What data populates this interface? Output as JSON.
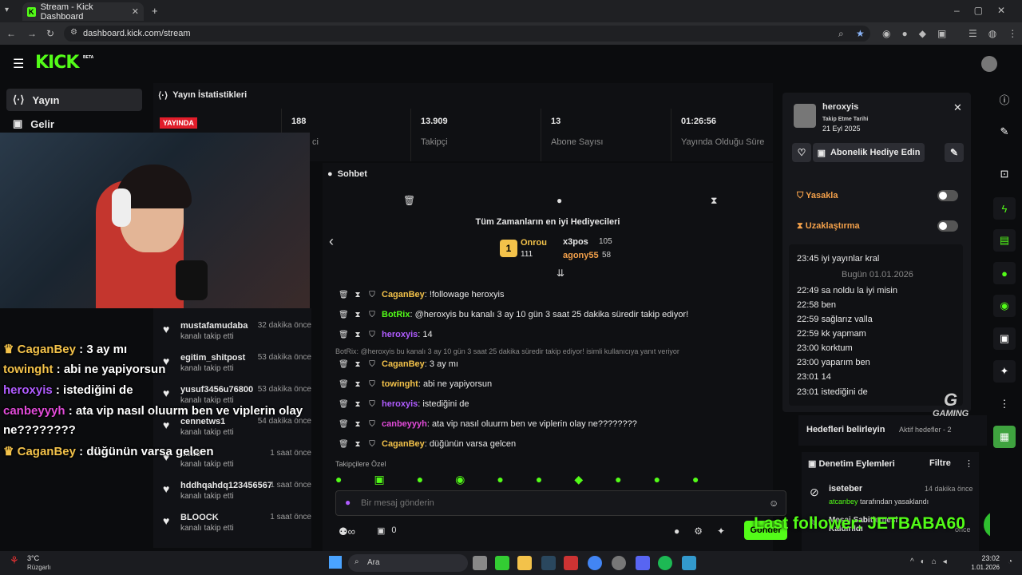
{
  "browser": {
    "tab_title": "Stream - Kick Dashboard",
    "url": "dashboard.kick.com/stream"
  },
  "kick": {
    "logo": "KICK",
    "beta": "BETA"
  },
  "sidebar": {
    "items": [
      {
        "label": "Yayın",
        "icon": "broadcast-icon"
      },
      {
        "label": "Gelir",
        "icon": "revenue-icon"
      }
    ]
  },
  "stats": {
    "title": "Yayın İstatistikleri",
    "live_badge": "YAYINDA",
    "viewers_value": "188",
    "viewers_label": "ci",
    "followers_value": "13.909",
    "followers_label": "Takipçi",
    "subs_value": "13",
    "subs_label": "Abone Sayısı",
    "duration_value": "01:26:56",
    "duration_label": "Yayında Olduğu Süre"
  },
  "overlay_chat": [
    {
      "user": "CaganBey",
      "text": " : 3 ay mı",
      "color": "#f3c24a",
      "crown": true
    },
    {
      "user": "towinght",
      "text": " : abi ne yapiyorsun",
      "color": "#f3c24a",
      "crown": false
    },
    {
      "user": "heroxyis",
      "text": " : istediğini de",
      "color": "#b05cff",
      "crown": false
    },
    {
      "user": "canbeyyyh",
      "text": " : ata vip nasıl oluurm ben ve viplerin olay",
      "color": "#e24bd9",
      "crown": false
    },
    {
      "user": "",
      "text": "ne????????",
      "color": "#ffffff",
      "crown": false
    },
    {
      "user": "CaganBey",
      "text": " : düğünün varsa gelcen",
      "color": "#f3c24a",
      "crown": true
    }
  ],
  "follows": [
    {
      "name": "mustafamudaba",
      "sub": "kanalı takip etti",
      "time": "32 dakika önce"
    },
    {
      "name": "egitim_shitpost",
      "sub": "kanalı takip etti",
      "time": "53 dakika önce"
    },
    {
      "name": "yusuf3456u76800",
      "sub": "kanalı takip etti",
      "time": "53 dakika önce"
    },
    {
      "name": "cennetws1",
      "sub": "kanalı takip etti",
      "time": "54 dakika önce"
    },
    {
      "name": "...nic",
      "sub": "kanalı takip etti",
      "time": "1 saat önce"
    },
    {
      "name": "hddhqahdq123456567",
      "sub": "kanalı takip etti",
      "time": "1 saat önce"
    },
    {
      "name": "BLOOCK",
      "sub": "kanalı takip etti",
      "time": "1 saat önce"
    }
  ],
  "chat": {
    "title": "Sohbet",
    "leaderboard_title": "Tüm Zamanların en iyi Hediyecileri",
    "leaders": [
      {
        "name": "Onrou",
        "value": "111"
      },
      {
        "name": "x3pos",
        "value": "105"
      },
      {
        "name": "agony55",
        "value": "58"
      }
    ],
    "messages": [
      {
        "user": "CaganBey",
        "color": "#f3c24a",
        "text": ": !followage heroxyis"
      },
      {
        "user": "BotRix",
        "color": "#53fc18",
        "text": ": @heroxyis bu kanalı 3 ay 10 gün 3 saat 25 dakika süredir takip ediyor!"
      },
      {
        "user": "heroxyis",
        "color": "#b05cff",
        "text": ": 14"
      },
      {
        "user": "CaganBey",
        "color": "#f3c24a",
        "text": ": 3 ay mı"
      },
      {
        "user": "towinght",
        "color": "#f3c24a",
        "text": ": abi ne yapiyorsun"
      },
      {
        "user": "heroxyis",
        "color": "#b05cff",
        "text": ": istediğini de"
      },
      {
        "user": "canbeyyyh",
        "color": "#e24bd9",
        "text": ": ata vip nasıl oluurm ben ve viplerin olay ne????????"
      },
      {
        "user": "CaganBey",
        "color": "#f3c24a",
        "text": ": düğünün varsa gelcen"
      }
    ],
    "reply_ref": "BotRix: @heroxyis bu kanalı 3 ay 10 gün 3 saat 25 dakika süredir takip ediyor! isimli kullanıcıya yanıt veriyor",
    "followers_only": "Takipçilere Özel",
    "input_placeholder": "Bir mesaj gönderin",
    "count": "0",
    "send": "Gönder"
  },
  "user_card": {
    "name": "heroxyis",
    "follow_label": "Takip Etme Tarihi",
    "follow_date": "21 Eyl 2025",
    "gift_button": "Abonelik Hediye Edin",
    "ban": "Yasakla",
    "timeout": "Uzaklaştırma",
    "history": [
      {
        "time": "23:45",
        "text": "iyi yayınlar kral"
      },
      {
        "time": "",
        "text": "Bugün 01.01.2026"
      },
      {
        "time": "22:49",
        "text": "sa noldu la iyi misin"
      },
      {
        "time": "22:58",
        "text": "ben"
      },
      {
        "time": "22:59",
        "text": "sağlarız valla"
      },
      {
        "time": "22:59",
        "text": "kk yapmam"
      },
      {
        "time": "23:00",
        "text": "korktum"
      },
      {
        "time": "23:00",
        "text": "yaparım ben"
      },
      {
        "time": "23:01",
        "text": "14"
      },
      {
        "time": "23:01",
        "text": "istediğini de"
      }
    ]
  },
  "goals": {
    "title": "Hedefleri belirleyin",
    "active": "Aktif hedefler - 2"
  },
  "moderation": {
    "title": "Denetim Eylemleri",
    "filter": "Filtre",
    "items": [
      {
        "name": "iseteber",
        "time": "14 dakika önce",
        "by": "atcanbey",
        "action": "tarafından yasaklandı"
      },
      {
        "name": "Mesaj Sabitlemesi Kaldırıldı",
        "time": "önce",
        "by": "",
        "action": ""
      }
    ]
  },
  "overlay_footer": "Last follower: JETBABA60",
  "overlay_gaming": "GAMING",
  "taskbar": {
    "weather_temp": "3°C",
    "weather_label": "Rüzgarlı",
    "search": "Ara",
    "time": "23:02",
    "date": "1.01.2026"
  }
}
